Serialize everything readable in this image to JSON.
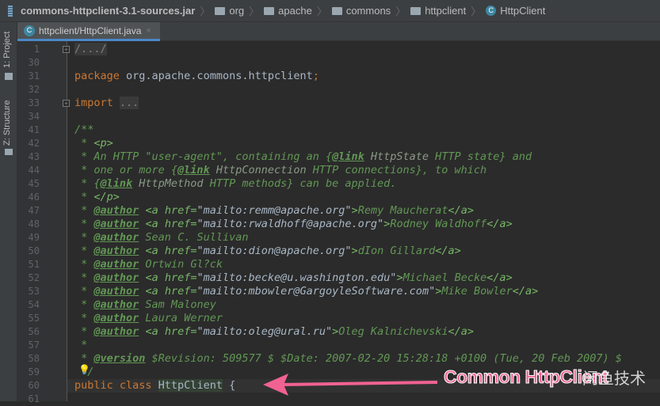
{
  "breadcrumb": [
    {
      "icon": "jar-icon",
      "label": "commons-httpclient-3.1-sources.jar"
    },
    {
      "icon": "folder-icon",
      "label": "org"
    },
    {
      "icon": "folder-icon",
      "label": "apache"
    },
    {
      "icon": "folder-icon",
      "label": "commons"
    },
    {
      "icon": "folder-icon",
      "label": "httpclient"
    },
    {
      "icon": "class-icon",
      "label": "HttpClient"
    }
  ],
  "sidebar": {
    "project": "1: Project",
    "structure": "Z: Structure"
  },
  "tab": {
    "label": "httpclient/HttpClient.java",
    "close": "×",
    "icon_letter": "C"
  },
  "lines": [
    {
      "n": "1",
      "fold": true,
      "segs": [
        [
          "fold",
          "/.../"
        ]
      ]
    },
    {
      "n": "30",
      "segs": []
    },
    {
      "n": "31",
      "segs": [
        [
          "kw",
          "package "
        ],
        [
          "",
          "org.apache.commons.httpclient"
        ],
        [
          "kw",
          ";"
        ]
      ]
    },
    {
      "n": "32",
      "segs": []
    },
    {
      "n": "33",
      "fold": true,
      "segs": [
        [
          "kw",
          "import "
        ],
        [
          "fold",
          "..."
        ]
      ]
    },
    {
      "n": "34",
      "segs": []
    },
    {
      "n": "41",
      "segs": [
        [
          "cm",
          "/**"
        ]
      ]
    },
    {
      "n": "42",
      "segs": [
        [
          "cm",
          " * "
        ],
        [
          "mk",
          "<p>"
        ]
      ]
    },
    {
      "n": "43",
      "segs": [
        [
          "cm",
          " * An HTTP \"user-agent\", containing an {"
        ],
        [
          "tag",
          "@link"
        ],
        [
          "ref",
          " HttpState"
        ],
        [
          "cm",
          " HTTP state} and"
        ]
      ]
    },
    {
      "n": "44",
      "segs": [
        [
          "cm",
          " * one or more {"
        ],
        [
          "tag",
          "@link"
        ],
        [
          "ref",
          " HttpConnection"
        ],
        [
          "cm",
          " HTTP connections}, to which"
        ]
      ]
    },
    {
      "n": "45",
      "segs": [
        [
          "cm",
          " * {"
        ],
        [
          "tag",
          "@link"
        ],
        [
          "ref",
          " HttpMethod"
        ],
        [
          "cm",
          " HTTP methods} can be applied."
        ]
      ]
    },
    {
      "n": "46",
      "segs": [
        [
          "cm",
          " * "
        ],
        [
          "mk",
          "</p>"
        ]
      ]
    },
    {
      "n": "47",
      "segs": [
        [
          "cm",
          " * "
        ],
        [
          "tag",
          "@author"
        ],
        [
          "cm",
          " "
        ],
        [
          "mk",
          "<a href="
        ],
        [
          "str",
          "\"mailto:remm@apache.org\""
        ],
        [
          "mk",
          ">"
        ],
        [
          "cm",
          "Remy Maucherat"
        ],
        [
          "mk",
          "</a>"
        ]
      ]
    },
    {
      "n": "48",
      "segs": [
        [
          "cm",
          " * "
        ],
        [
          "tag",
          "@author"
        ],
        [
          "cm",
          " "
        ],
        [
          "mk",
          "<a href="
        ],
        [
          "str",
          "\"mailto:rwaldhoff@apache.org\""
        ],
        [
          "mk",
          ">"
        ],
        [
          "cm",
          "Rodney Waldhoff"
        ],
        [
          "mk",
          "</a>"
        ]
      ]
    },
    {
      "n": "49",
      "segs": [
        [
          "cm",
          " * "
        ],
        [
          "tag",
          "@author"
        ],
        [
          "cm",
          " Sean C. Sullivan"
        ]
      ]
    },
    {
      "n": "50",
      "segs": [
        [
          "cm",
          " * "
        ],
        [
          "tag",
          "@author"
        ],
        [
          "cm",
          " "
        ],
        [
          "mk",
          "<a href="
        ],
        [
          "str",
          "\"mailto:dion@apache.org\""
        ],
        [
          "mk",
          ">"
        ],
        [
          "cm",
          "dIon Gillard"
        ],
        [
          "mk",
          "</a>"
        ]
      ]
    },
    {
      "n": "51",
      "segs": [
        [
          "cm",
          " * "
        ],
        [
          "tag",
          "@author"
        ],
        [
          "cm",
          " Ortwin Gl?ck"
        ]
      ]
    },
    {
      "n": "52",
      "segs": [
        [
          "cm",
          " * "
        ],
        [
          "tag",
          "@author"
        ],
        [
          "cm",
          " "
        ],
        [
          "mk",
          "<a href="
        ],
        [
          "str",
          "\"mailto:becke@u.washington.edu\""
        ],
        [
          "mk",
          ">"
        ],
        [
          "cm",
          "Michael Becke"
        ],
        [
          "mk",
          "</a>"
        ]
      ]
    },
    {
      "n": "53",
      "segs": [
        [
          "cm",
          " * "
        ],
        [
          "tag",
          "@author"
        ],
        [
          "cm",
          " "
        ],
        [
          "mk",
          "<a href="
        ],
        [
          "str",
          "\"mailto:mbowler@GargoyleSoftware.com\""
        ],
        [
          "mk",
          ">"
        ],
        [
          "cm",
          "Mike Bowler"
        ],
        [
          "mk",
          "</a>"
        ]
      ]
    },
    {
      "n": "54",
      "segs": [
        [
          "cm",
          " * "
        ],
        [
          "tag",
          "@author"
        ],
        [
          "cm",
          " Sam Maloney"
        ]
      ]
    },
    {
      "n": "55",
      "segs": [
        [
          "cm",
          " * "
        ],
        [
          "tag",
          "@author"
        ],
        [
          "cm",
          " Laura Werner"
        ]
      ]
    },
    {
      "n": "56",
      "segs": [
        [
          "cm",
          " * "
        ],
        [
          "tag",
          "@author"
        ],
        [
          "cm",
          " "
        ],
        [
          "mk",
          "<a href="
        ],
        [
          "str",
          "\"mailto:oleg@ural.ru\""
        ],
        [
          "mk",
          ">"
        ],
        [
          "cm",
          "Oleg Kalnichevski"
        ],
        [
          "mk",
          "</a>"
        ]
      ]
    },
    {
      "n": "57",
      "segs": [
        [
          "cm",
          " *"
        ]
      ]
    },
    {
      "n": "58",
      "segs": [
        [
          "cm",
          " * "
        ],
        [
          "tag",
          "@version"
        ],
        [
          "cm",
          " $Revision: 509577 $ $Date: 2007-02-20 15:28:18 +0100 (Tue, 20 Feb 2007) $"
        ]
      ]
    },
    {
      "n": "59",
      "bulb": true,
      "segs": [
        [
          "cm",
          " */"
        ]
      ]
    },
    {
      "n": "60",
      "current": true,
      "segs": [
        [
          "kw",
          "public class "
        ],
        [
          "hl",
          "HttpClient"
        ],
        [
          "",
          " {"
        ]
      ]
    },
    {
      "n": "61",
      "segs": []
    }
  ],
  "annotation": {
    "text": "Common HttpClient",
    "color": "#f06292"
  },
  "watermark": "闲鱼技术"
}
